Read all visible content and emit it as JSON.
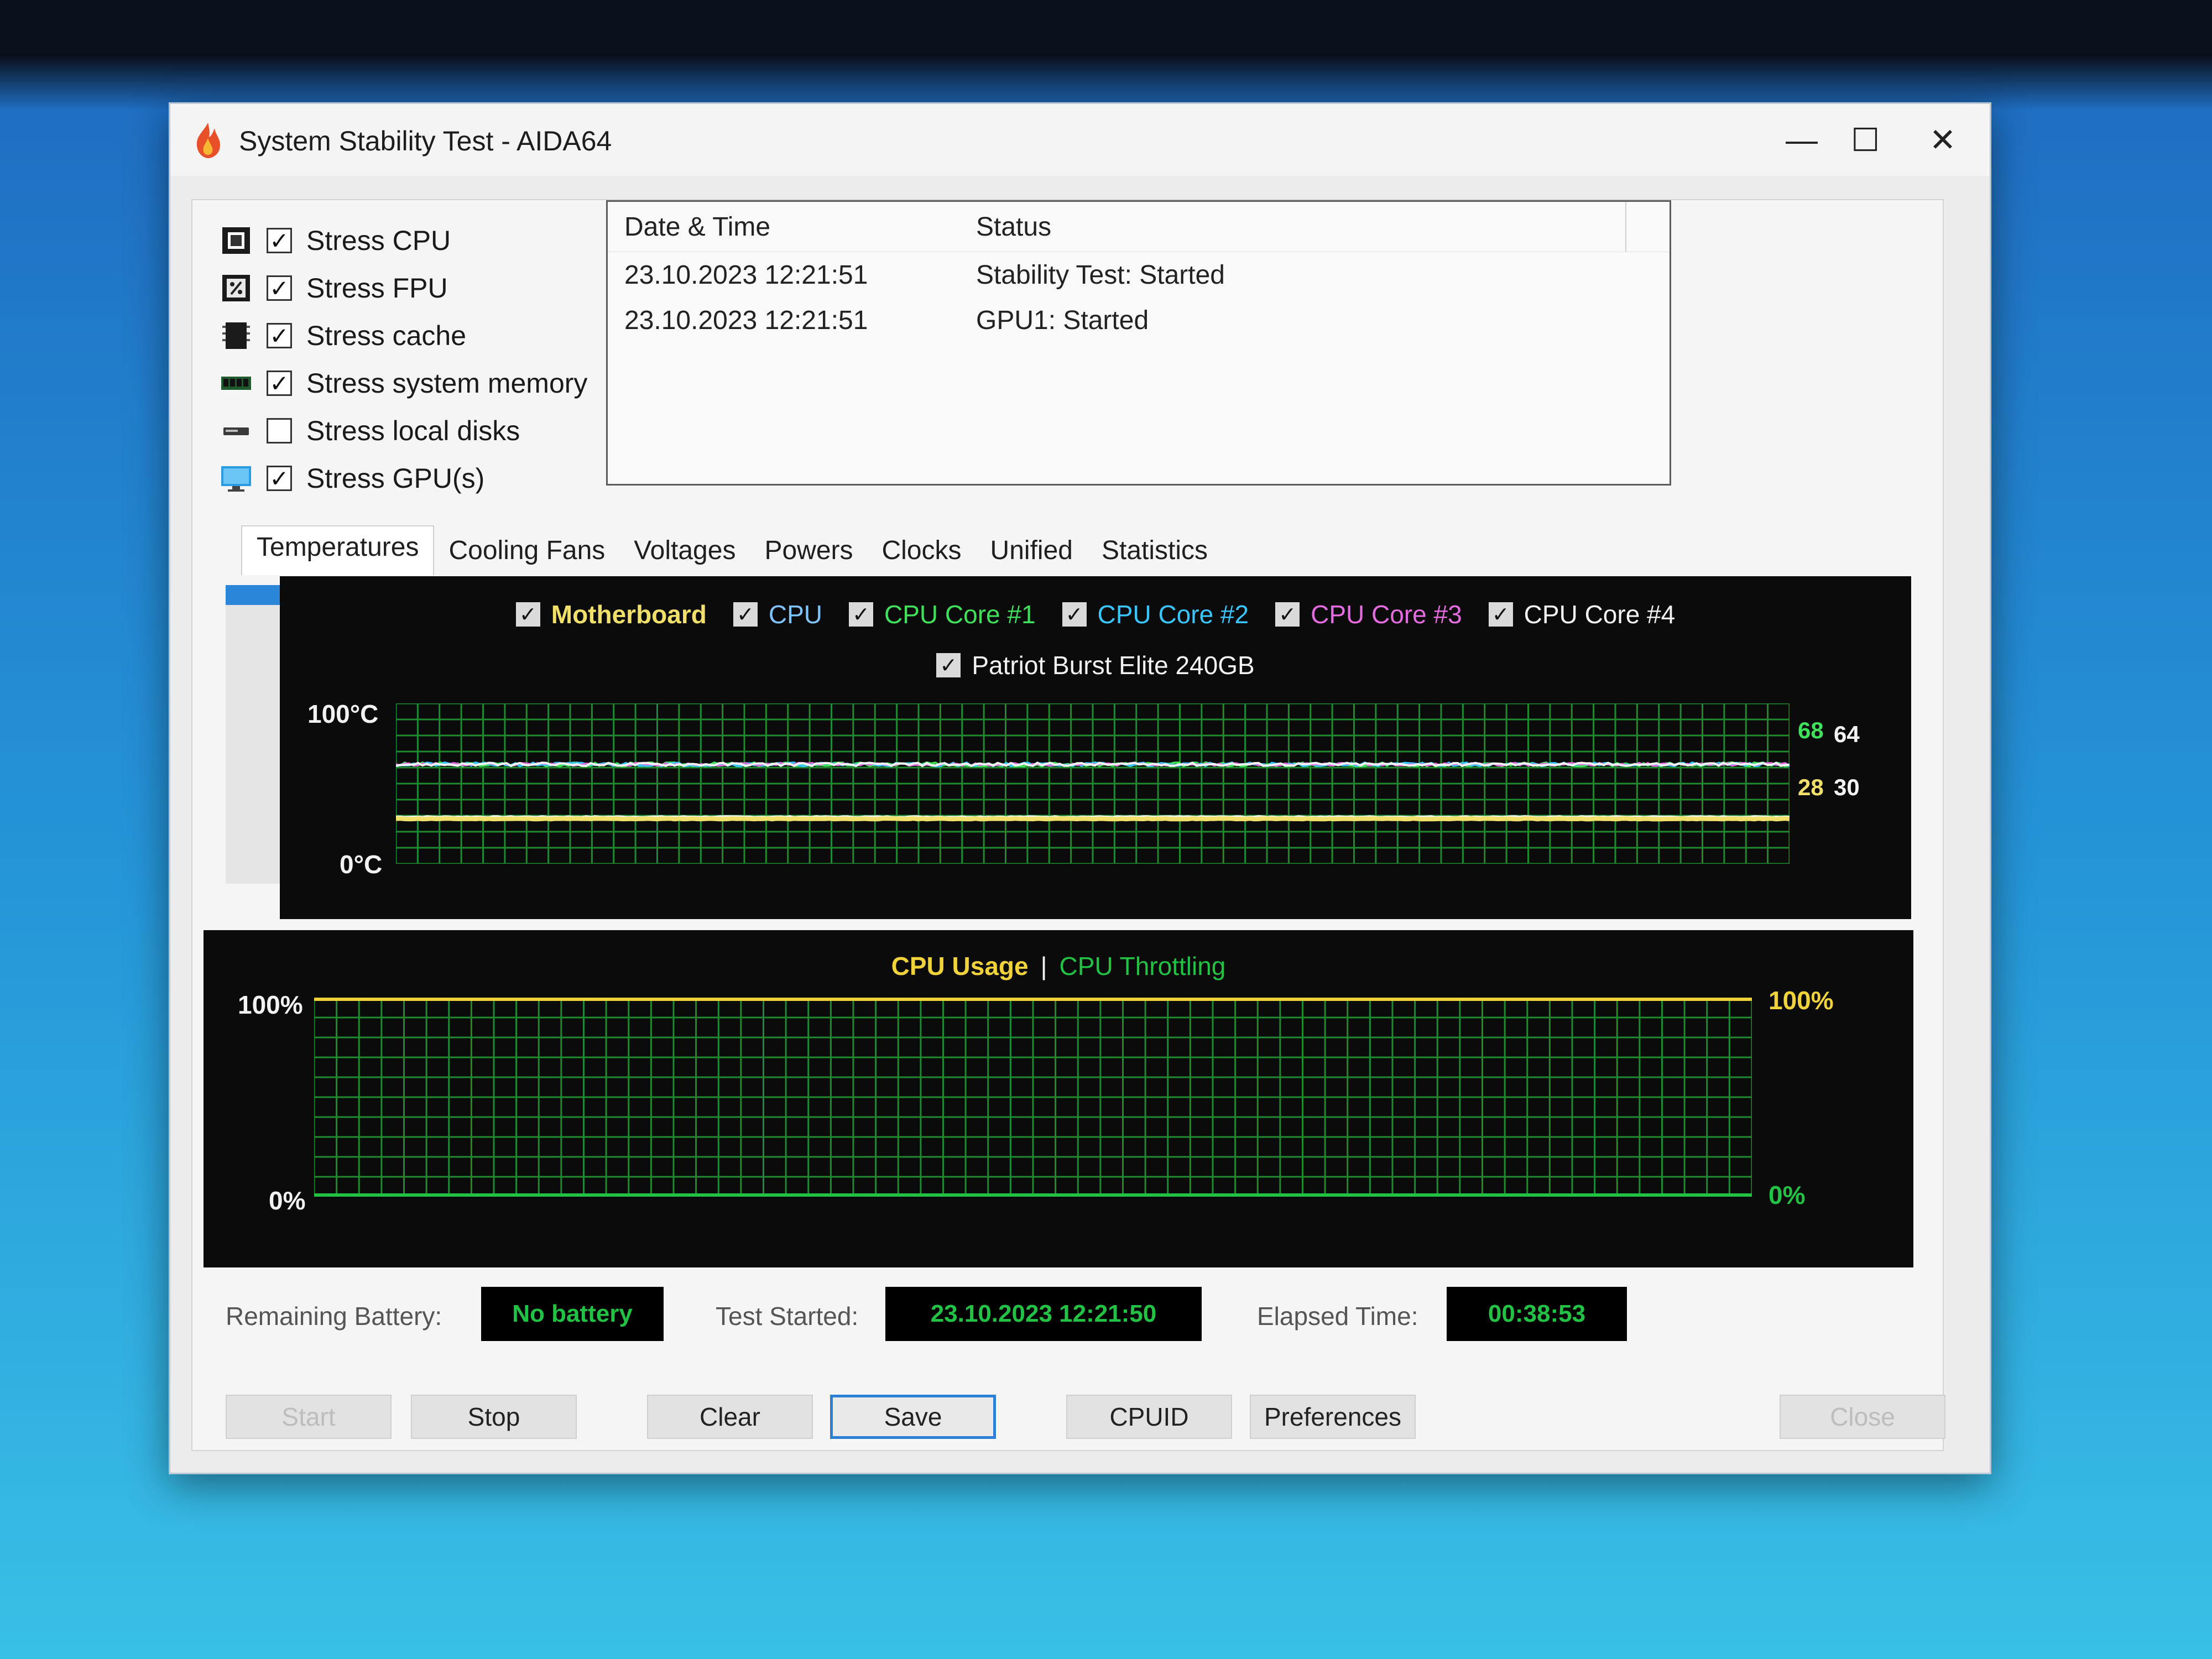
{
  "window": {
    "title": "System Stability Test - AIDA64",
    "minimize_glyph": "—",
    "maximize_glyph": "☐",
    "close_glyph": "✕"
  },
  "stress_options": [
    {
      "label": "Stress CPU",
      "checked": true,
      "icon": "cpu-chip-icon"
    },
    {
      "label": "Stress FPU",
      "checked": true,
      "icon": "fpu-icon"
    },
    {
      "label": "Stress cache",
      "checked": true,
      "icon": "cache-icon"
    },
    {
      "label": "Stress system memory",
      "checked": true,
      "icon": "memory-module-icon"
    },
    {
      "label": "Stress local disks",
      "checked": false,
      "icon": "disk-drive-icon"
    },
    {
      "label": "Stress GPU(s)",
      "checked": true,
      "icon": "monitor-icon"
    }
  ],
  "check_glyph": "✓",
  "log": {
    "headers": {
      "datetime": "Date & Time",
      "status": "Status"
    },
    "rows": [
      {
        "datetime": "23.10.2023 12:21:51",
        "status": "Stability Test: Started"
      },
      {
        "datetime": "23.10.2023 12:21:51",
        "status": "GPU1: Started"
      }
    ]
  },
  "tabs": [
    "Temperatures",
    "Cooling Fans",
    "Voltages",
    "Powers",
    "Clocks",
    "Unified",
    "Statistics"
  ],
  "active_tab": "Temperatures",
  "temp_chart": {
    "legend": [
      {
        "name": "Motherboard",
        "color": "#f0e06a"
      },
      {
        "name": "CPU",
        "color": "#7fc3ff"
      },
      {
        "name": "CPU Core #1",
        "color": "#3fe05a"
      },
      {
        "name": "CPU Core #2",
        "color": "#39c6ff"
      },
      {
        "name": "CPU Core #3",
        "color": "#e46be0"
      },
      {
        "name": "CPU Core #4",
        "color": "#f2f2f2"
      },
      {
        "name": "Patriot Burst Elite 240GB",
        "color": "#f2f2f2"
      }
    ],
    "y_max_label": "100°C",
    "y_min_label": "0°C",
    "value_labels": {
      "a": "68",
      "b": "64",
      "c": "28",
      "d": "30"
    }
  },
  "usage_chart": {
    "title_usage": "CPU Usage",
    "separator": "|",
    "title_throttle": "CPU Throttling",
    "usage_color": "#f0d23a",
    "throttle_color": "#22c244",
    "left_max": "100%",
    "left_min": "0%",
    "right_max": "100%",
    "right_min": "0%"
  },
  "chart_data": [
    {
      "type": "line",
      "title": "",
      "ylim": [
        0,
        100
      ],
      "grid": true,
      "legend": "top",
      "series": [
        {
          "name": "CPU Core #1",
          "last_value": 68,
          "approx_level": 62
        },
        {
          "name": "CPU",
          "last_value": 64,
          "approx_level": 62
        },
        {
          "name": "Motherboard",
          "last_value": 28,
          "approx_level": 28
        },
        {
          "name": "Patriot Burst Elite 240GB",
          "last_value": 30,
          "approx_level": 29
        }
      ]
    },
    {
      "type": "line",
      "title": "",
      "ylim": [
        0,
        100
      ],
      "grid": true,
      "series": [
        {
          "name": "CPU Usage",
          "approx_level": 100
        },
        {
          "name": "CPU Throttling",
          "approx_level": 0
        }
      ]
    }
  ],
  "status": {
    "battery_label": "Remaining Battery:",
    "battery_value": "No battery",
    "started_label": "Test Started:",
    "started_value": "23.10.2023 12:21:50",
    "elapsed_label": "Elapsed Time:",
    "elapsed_value": "00:38:53"
  },
  "buttons": {
    "start": "Start",
    "stop": "Stop",
    "clear": "Clear",
    "save": "Save",
    "cpuid": "CPUID",
    "preferences": "Preferences",
    "close": "Close"
  }
}
